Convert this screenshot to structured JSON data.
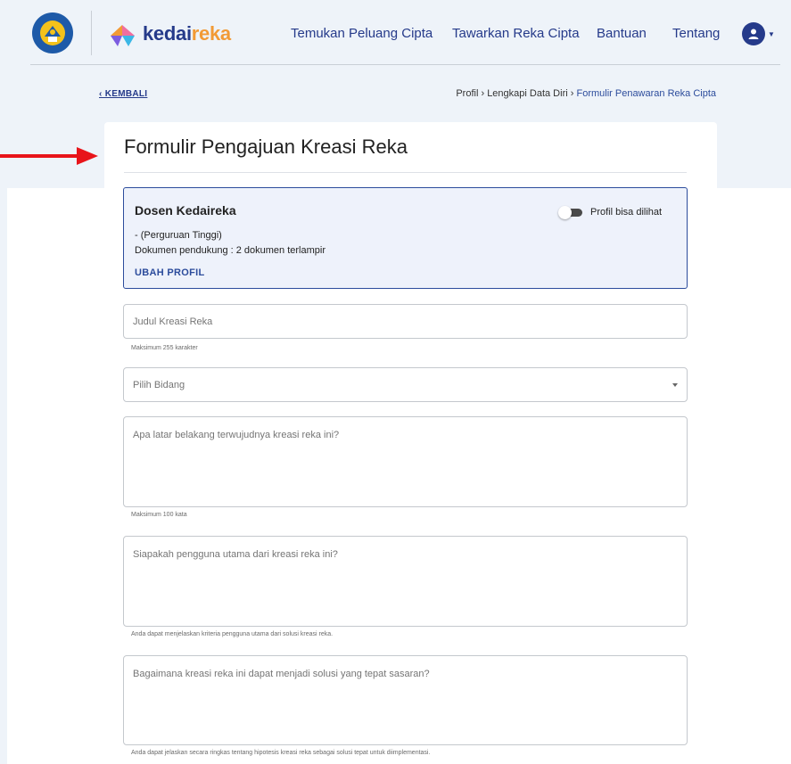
{
  "header": {
    "brand_prefix": "kedai",
    "brand_suffix": "reka",
    "nav": [
      {
        "label": "Temukan Peluang Cipta"
      },
      {
        "label": "Tawarkan Reka Cipta"
      },
      {
        "label": "Bantuan"
      },
      {
        "label": "Tentang"
      }
    ],
    "user_icon": "user-avatar-icon"
  },
  "subheader": {
    "back_label": "‹ KEMBALI",
    "breadcrumb": [
      {
        "label": "Profil"
      },
      {
        "label": "Lengkapi Data Diri"
      },
      {
        "label": "Formulir Penawaran Reka Cipta"
      }
    ],
    "separator": "›"
  },
  "form": {
    "title": "Formulir Pengajuan Kreasi Reka",
    "profile": {
      "name": "Dosen Kedaireka",
      "line1": "- (Perguruan Tinggi)",
      "line2": "Dokumen pendukung : 2 dokumen terlampir",
      "edit_label": "UBAH PROFIL",
      "toggle_label": "Profil bisa dilihat"
    },
    "fields": [
      {
        "placeholder": "Judul Kreasi Reka",
        "hint": "Maksimum 255 karakter"
      },
      {
        "placeholder": "Pilih Bidang",
        "hint": ""
      },
      {
        "placeholder": "Apa latar belakang terwujudnya kreasi reka ini?",
        "hint": "Maksimum 100 kata"
      },
      {
        "placeholder": "Siapakah pengguna utama dari kreasi reka ini?",
        "hint": "Anda dapat menjelaskan kriteria pengguna utama dari solusi kreasi reka."
      },
      {
        "placeholder": "Bagaimana kreasi reka ini dapat menjadi solusi yang tepat sasaran?",
        "hint": "Anda dapat jelaskan secara ringkas tentang hipotesis kreasi reka sebagai solusi tepat untuk diimplementasi."
      }
    ]
  },
  "colors": {
    "brand_blue": "#253a8a",
    "brand_orange": "#f29a35",
    "arrow_red": "#e8141a",
    "band_bg": "#eef3f9"
  }
}
